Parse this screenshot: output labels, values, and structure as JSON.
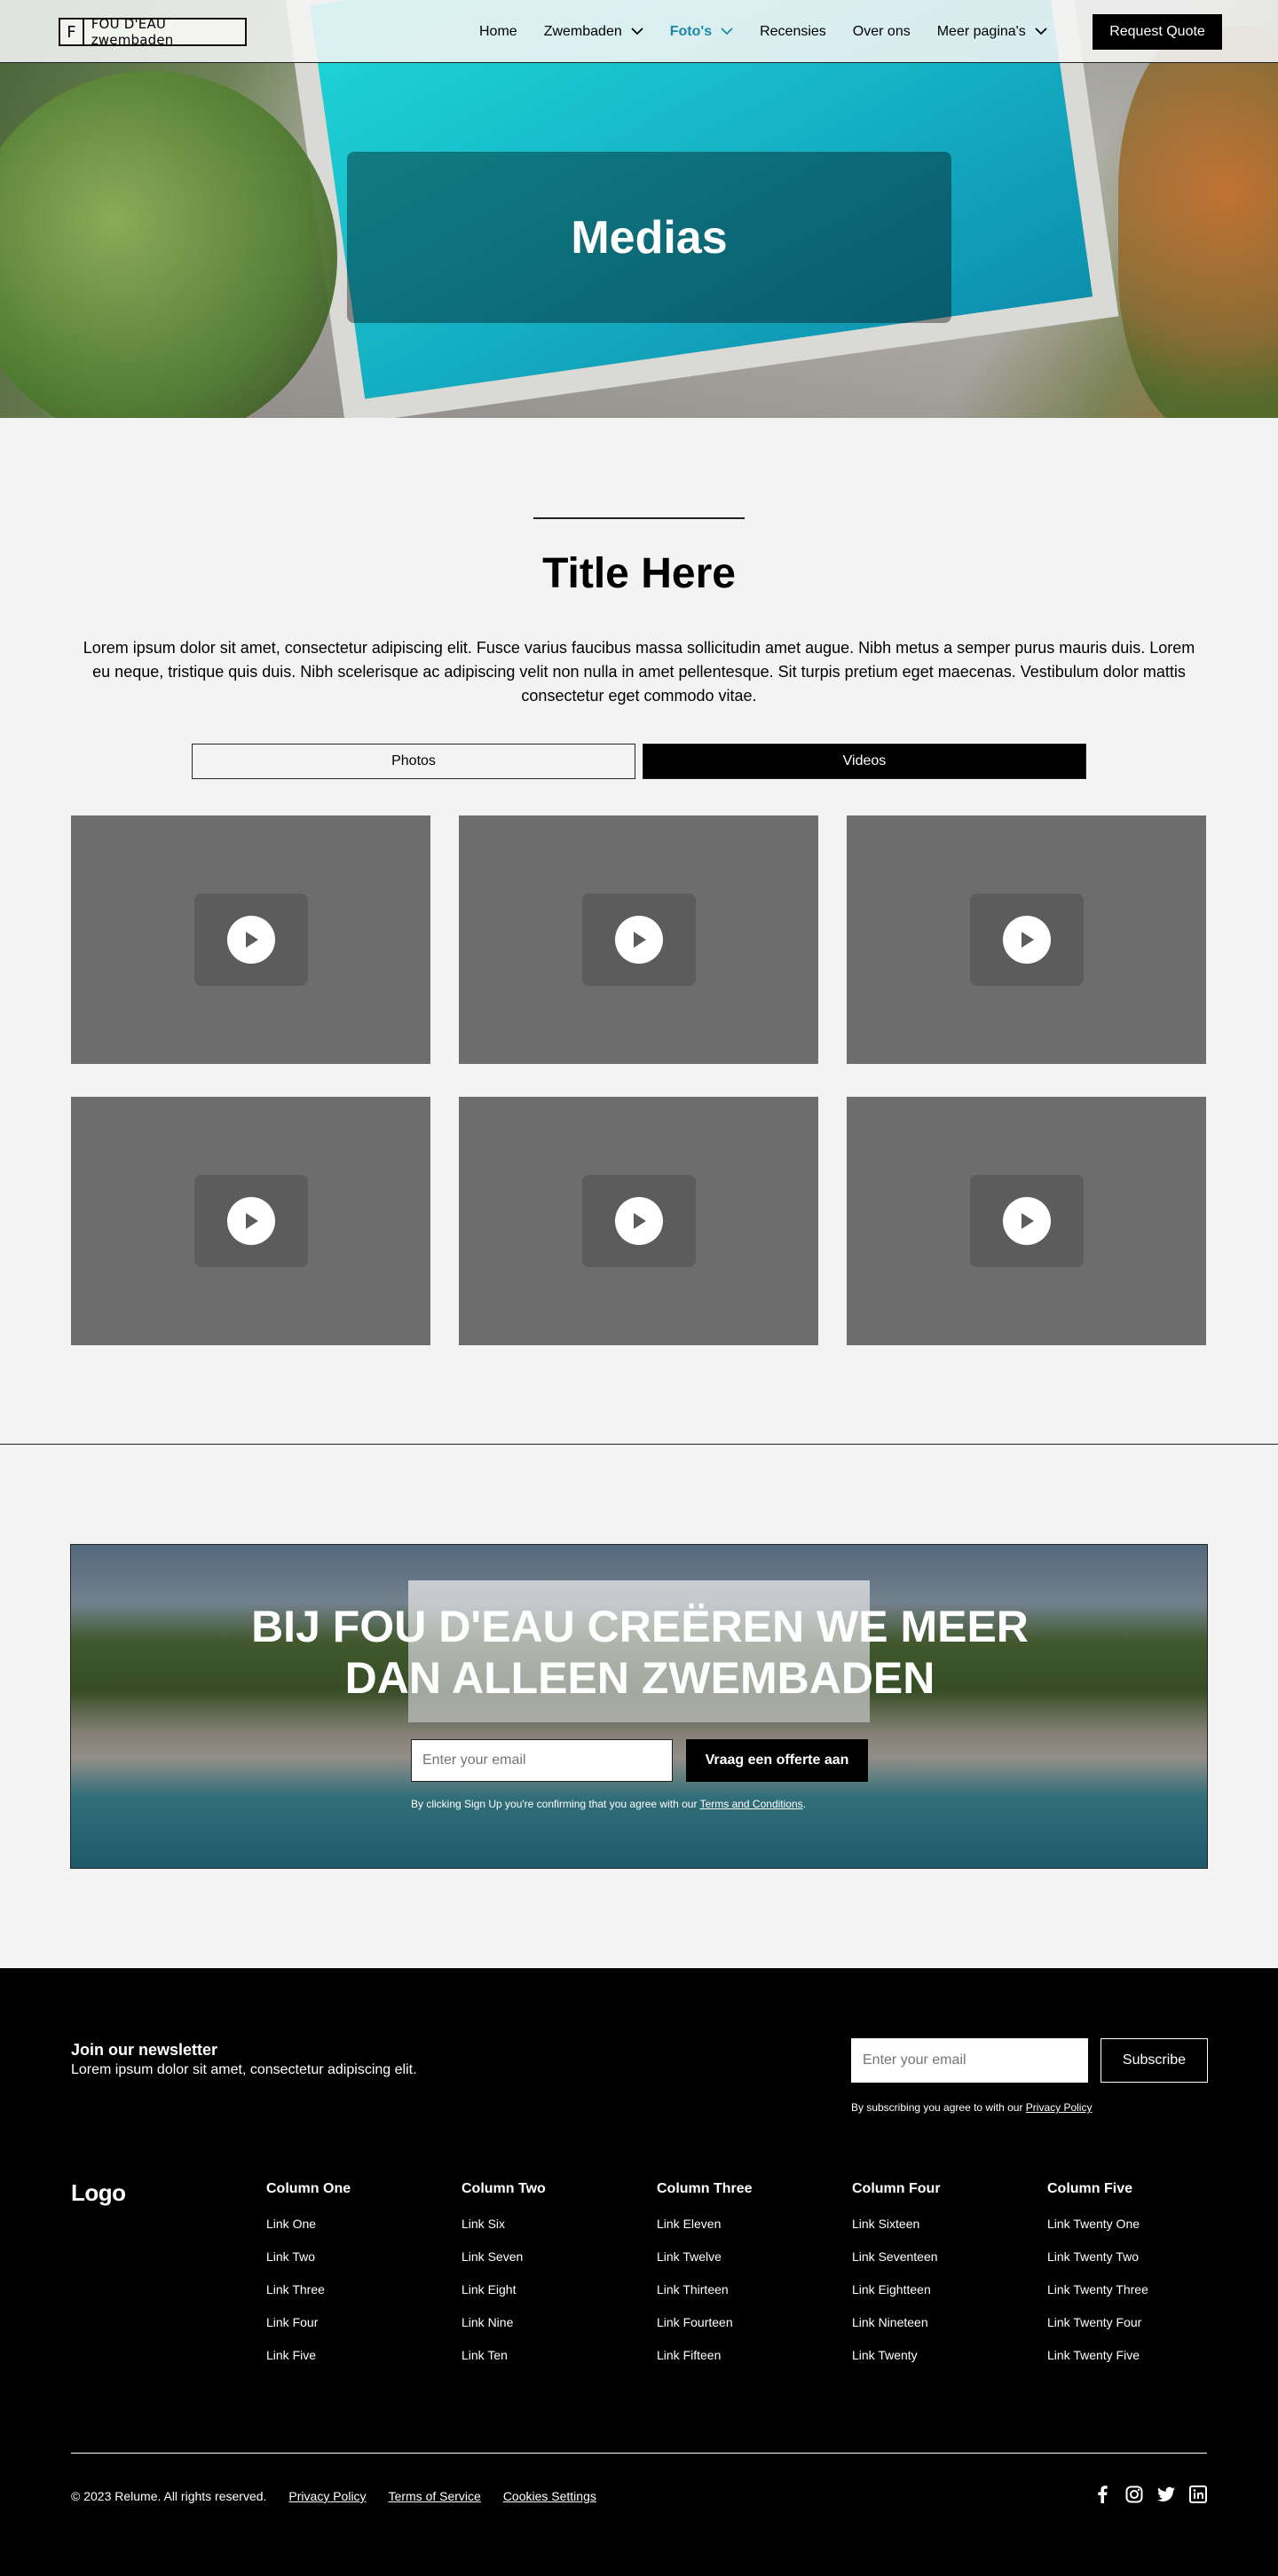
{
  "nav": {
    "logo_f": "F",
    "logo_text": "FOU D'EAU zwembaden",
    "items": [
      {
        "label": "Home",
        "dropdown": false,
        "active": false
      },
      {
        "label": "Zwembaden",
        "dropdown": true,
        "active": false
      },
      {
        "label": "Foto's",
        "dropdown": true,
        "active": true
      },
      {
        "label": "Recensies",
        "dropdown": false,
        "active": false
      },
      {
        "label": "Over ons",
        "dropdown": false,
        "active": false
      },
      {
        "label": "Meer pagina's",
        "dropdown": true,
        "active": false
      }
    ],
    "cta": "Request Quote",
    "active_color": "#1b88a8"
  },
  "hero": {
    "title": "Medias"
  },
  "section": {
    "title": "Title Here",
    "description": "Lorem ipsum dolor sit amet, consectetur adipiscing elit. Fusce varius faucibus massa sollicitudin amet augue. Nibh metus a semper purus mauris duis. Lorem eu neque, tristique quis duis. Nibh scelerisque ac adipiscing velit non nulla in amet pellentesque. Sit turpis pretium eget maecenas. Vestibulum dolor mattis consectetur eget commodo vitae.",
    "tabs": [
      {
        "label": "Photos",
        "selected": false
      },
      {
        "label": "Videos",
        "selected": true
      }
    ],
    "video_count": 6,
    "icon": "play-icon"
  },
  "cta": {
    "title_line1": "BIJ FOU D'EAU CREËREN WE MEER",
    "title_line2": "DAN ALLEEN ZWEMBADEN",
    "email_placeholder": "Enter your email",
    "button": "Vraag een offerte aan",
    "note_prefix": "By clicking Sign Up you're confirming that you agree with our ",
    "note_link": "Terms and Conditions",
    "note_suffix": "."
  },
  "footer": {
    "newsletter_title": "Join our newsletter",
    "newsletter_desc": "Lorem ipsum dolor sit amet, consectetur adipiscing elit.",
    "email_placeholder": "Enter your email",
    "subscribe": "Subscribe",
    "note_prefix": "By subscribing you agree to with our ",
    "note_link": "Privacy Policy",
    "logo": "Logo",
    "columns": [
      {
        "title": "Column One",
        "links": [
          "Link One",
          "Link Two",
          "Link Three",
          "Link Four",
          "Link Five"
        ]
      },
      {
        "title": "Column Two",
        "links": [
          "Link Six",
          "Link Seven",
          "Link Eight",
          "Link Nine",
          "Link Ten"
        ]
      },
      {
        "title": "Column Three",
        "links": [
          "Link Eleven",
          "Link Twelve",
          "Link Thirteen",
          "Link Fourteen",
          "Link Fifteen"
        ]
      },
      {
        "title": "Column Four",
        "links": [
          "Link Sixteen",
          "Link Seventeen",
          "Link Eightteen",
          "Link Nineteen",
          "Link Twenty"
        ]
      },
      {
        "title": "Column Five",
        "links": [
          "Link Twenty One",
          "Link Twenty Two",
          "Link Twenty Three",
          "Link Twenty Four",
          "Link Twenty Five"
        ]
      }
    ],
    "copyright": "© 2023 Relume. All rights reserved.",
    "legal_links": [
      "Privacy Policy",
      "Terms of Service",
      "Cookies Settings"
    ],
    "socials": [
      "facebook-icon",
      "instagram-icon",
      "twitter-icon",
      "linkedin-icon"
    ]
  }
}
